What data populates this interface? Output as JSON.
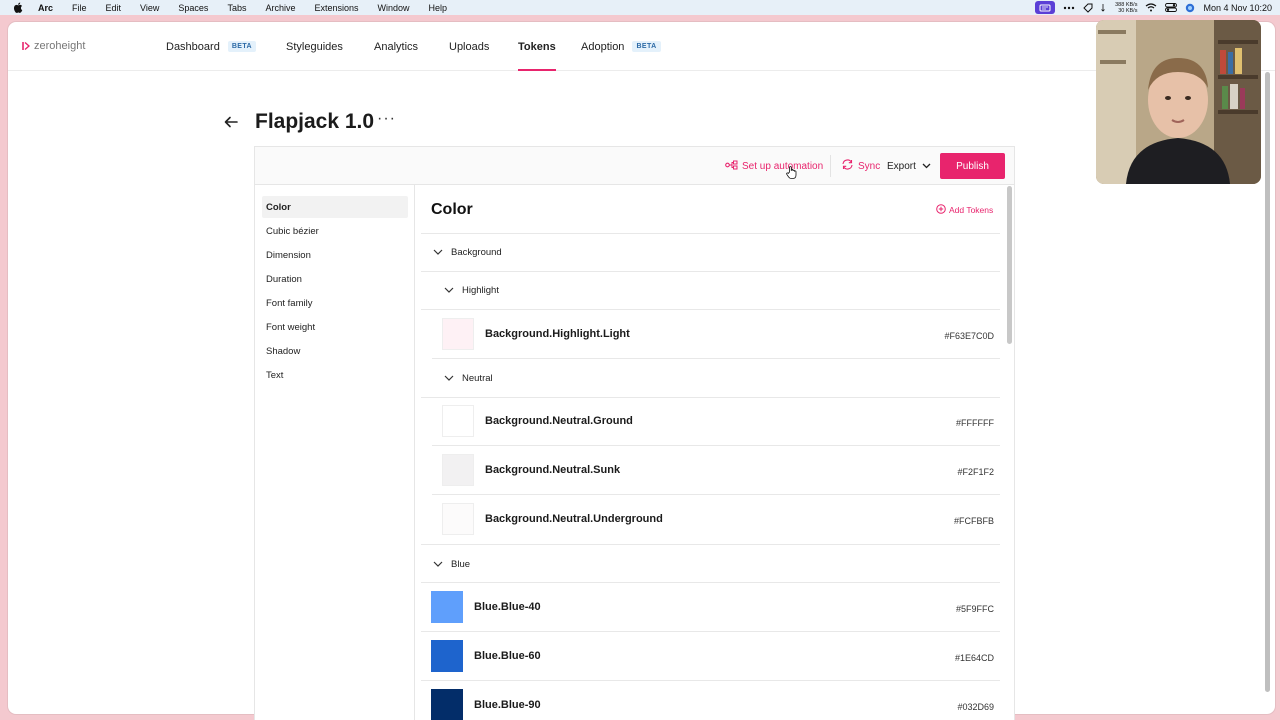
{
  "menubar": {
    "app": "Arc",
    "items": [
      "File",
      "Edit",
      "View",
      "Spaces",
      "Tabs",
      "Archive",
      "Extensions",
      "Window",
      "Help"
    ],
    "net_up": "388 KB/s",
    "net_down": "30 KB/s",
    "datetime": "Mon 4 Nov 10:20"
  },
  "header": {
    "logo_text": "zeroheight",
    "nav": [
      {
        "label": "Dashboard",
        "badge": "BETA"
      },
      {
        "label": "Styleguides"
      },
      {
        "label": "Analytics"
      },
      {
        "label": "Uploads"
      },
      {
        "label": "Tokens",
        "active": true
      },
      {
        "label": "Adoption",
        "badge": "BETA"
      }
    ]
  },
  "page": {
    "title": "Flapjack 1.0",
    "more": "···"
  },
  "toolbar": {
    "automation_label": "Set up automation",
    "sync_label": "Sync",
    "export_label": "Export",
    "publish_label": "Publish"
  },
  "sidebar": {
    "items": [
      "Color",
      "Cubic bézier",
      "Dimension",
      "Duration",
      "Font family",
      "Font weight",
      "Shadow",
      "Text"
    ]
  },
  "content": {
    "section_title": "Color",
    "add_tokens_label": "Add Tokens",
    "groups": {
      "background": "Background",
      "highlight": "Highlight",
      "neutral": "Neutral",
      "blue": "Blue"
    },
    "tokens": [
      {
        "name": "Background.Highlight.Light",
        "value": "#F63E7C0D",
        "swatch": "#fef1f5"
      },
      {
        "name": "Background.Neutral.Ground",
        "value": "#FFFFFF",
        "swatch": "#FFFFFF"
      },
      {
        "name": "Background.Neutral.Sunk",
        "value": "#F2F1F2",
        "swatch": "#F2F1F2"
      },
      {
        "name": "Background.Neutral.Underground",
        "value": "#FCFBFB",
        "swatch": "#FCFBFB"
      },
      {
        "name": "Blue.Blue-40",
        "value": "#5F9FFC",
        "swatch": "#5F9FFC"
      },
      {
        "name": "Blue.Blue-60",
        "value": "#1E64CD",
        "swatch": "#1E64CD"
      },
      {
        "name": "Blue.Blue-90",
        "value": "#032D69",
        "swatch": "#032D69"
      }
    ]
  },
  "colors": {
    "accent": "#e8246d",
    "beta_bg": "#e4f1fb",
    "page_bg": "#f4c9cf"
  }
}
